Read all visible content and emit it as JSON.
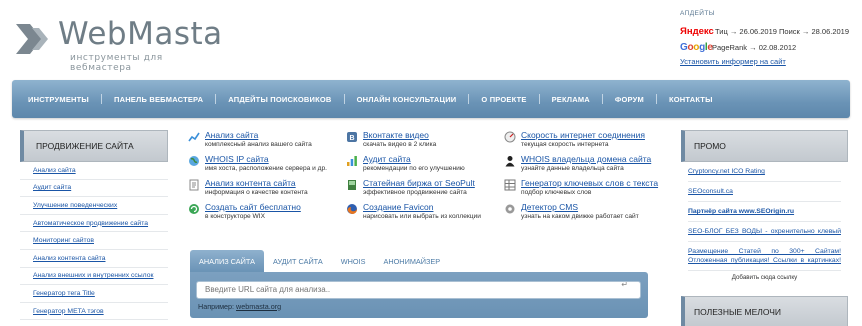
{
  "logo": {
    "title": "WebMasta",
    "subtitle": "инструменты для вебмастера"
  },
  "updates": {
    "title": "АПДЕЙТЫ",
    "yandex_logo": "Яндекс",
    "yandex_text": "Тиц → 26.06.2019 Поиск → 28.06.2019",
    "google_logo": "Google",
    "google_text": "PageRank → 02.08.2012",
    "informer_link": "Установить информер на сайт"
  },
  "nav": [
    "ИНСТРУМЕНТЫ",
    "ПАНЕЛЬ ВЕБМАСТЕРА",
    "АПДЕЙТЫ ПОИСКОВИКОВ",
    "ОНЛАЙН КОНСУЛЬТАЦИИ",
    "О ПРОЕКТЕ",
    "РЕКЛАМА",
    "ФОРУМ",
    "КОНТАКТЫ"
  ],
  "sidebar": {
    "title": "ПРОДВИЖЕНИЕ САЙТА",
    "items": [
      "Анализ сайта",
      "Аудит сайта",
      "Улучшение поведенческих",
      "Автоматическое продвижение сайта",
      "Мониторинг сайтов",
      "Анализ контента сайта",
      "Анализ внешних и внутренних ссылок",
      "Генератор тега Title",
      "Генератор META тэгов"
    ]
  },
  "tools": [
    {
      "title": "Анализ сайта",
      "desc": "комплексный анализ вашего сайта",
      "icon": "chart-icon"
    },
    {
      "title": "WHOIS IP сайта",
      "desc": "имя хоста, расположение сервера и др.",
      "icon": "globe-icon"
    },
    {
      "title": "Анализ контента сайта",
      "desc": "информация о качестве контента",
      "icon": "document-icon"
    },
    {
      "title": "Создать сайт бесплатно",
      "desc": "в конструкторе WIX",
      "icon": "refresh-icon"
    },
    {
      "title": "Вконтакте видео",
      "desc": "скачать видео в 2 клика",
      "icon": "vk-icon"
    },
    {
      "title": "Аудит сайта",
      "desc": "рекомендации по его улучшению",
      "icon": "bar-chart-icon"
    },
    {
      "title": "Статейная биржа от SeoPult",
      "desc": "эффективное продвижение сайта",
      "icon": "book-icon"
    },
    {
      "title": "Создание Favicon",
      "desc": "нарисовать или выбрать из коллекции",
      "icon": "firefox-icon"
    },
    {
      "title": "Скорость интернет соединения",
      "desc": "текущая скорость интернета",
      "icon": "speedometer-icon"
    },
    {
      "title": "WHOIS владельца домена сайта",
      "desc": "узнайте данные владельца сайта",
      "icon": "person-icon"
    },
    {
      "title": "Генератор ключевых слов с текста",
      "desc": "подбор ключевых слов",
      "icon": "grid-icon"
    },
    {
      "title": "Детектор CMS",
      "desc": "узнать на каком движке работает сайт",
      "icon": "gear-icon"
    }
  ],
  "search": {
    "tabs": [
      "АНАЛИЗ САЙТА",
      "АУДИТ САЙТА",
      "WHOIS",
      "АНОНИМАЙЗЕР"
    ],
    "placeholder": "Введите URL сайта для анализа..",
    "example_label": "Например:",
    "example_link": "webmasta.org",
    "button_glyph": "↵"
  },
  "promo": {
    "title": "ПРОМО",
    "items": [
      "Cryptoncy.net ICO Rating",
      "SEOconsult.ca",
      "Партнёр сайта www.SEOrigin.ru",
      "SEO-БЛОГ БЕЗ ВОДЫ - охренительно клевый",
      "Размещение Статей по 300+ Сайтам! Отложенная публикация! Ссылки в картинках!"
    ],
    "add_link": "Добавить сюда ссылку"
  },
  "useful": {
    "title": "ПОЛЕЗНЫЕ МЕЛОЧИ"
  }
}
